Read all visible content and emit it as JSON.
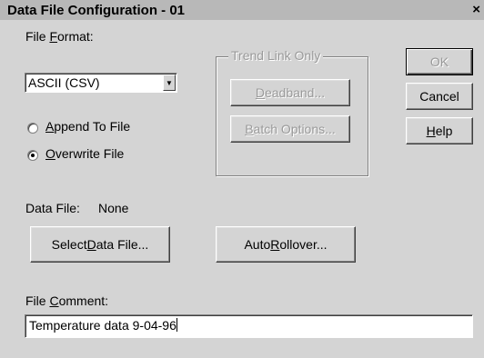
{
  "window": {
    "title": "Data File Configuration - 01",
    "close_glyph": "×"
  },
  "file_format": {
    "label_pre": "File ",
    "label_accel": "F",
    "label_post": "ormat:",
    "value": "ASCII (CSV)",
    "arrow_glyph": "▼"
  },
  "write_mode": {
    "append": {
      "pre": "",
      "accel": "A",
      "post": "ppend To File",
      "selected": false
    },
    "overwrite": {
      "pre": "",
      "accel": "O",
      "post": "verwrite File",
      "selected": true
    }
  },
  "trend_link": {
    "title": "Trend Link Only",
    "deadband": {
      "pre": "",
      "accel": "D",
      "post": "eadband...",
      "enabled": false
    },
    "batch_options": {
      "pre": "",
      "accel": "B",
      "post": "atch Options...",
      "enabled": false
    }
  },
  "buttons": {
    "ok": {
      "label": "OK",
      "enabled": false
    },
    "cancel": {
      "label": "Cancel"
    },
    "help": {
      "pre": "",
      "accel": "H",
      "post": "elp"
    }
  },
  "data_file": {
    "label": "Data File:",
    "value": "None"
  },
  "select_data_file": {
    "pre": "Select ",
    "accel": "D",
    "post": "ata File..."
  },
  "auto_rollover": {
    "pre": "Auto ",
    "accel": "R",
    "post": "ollover..."
  },
  "file_comment": {
    "label_pre": "File ",
    "label_accel": "C",
    "label_post": "omment:",
    "value": "Temperature data 9-04-96"
  }
}
